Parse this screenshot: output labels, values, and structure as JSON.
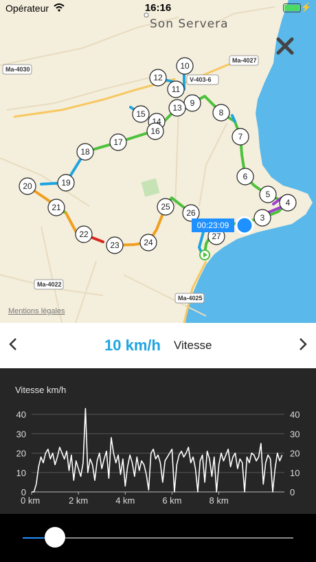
{
  "status_bar": {
    "carrier": "Opérateur",
    "time": "16:16",
    "battery_level": 1.0
  },
  "map": {
    "town": "Son Servera",
    "legal": "Mentions légales",
    "road_labels": [
      "Ma-4030",
      "Ma-4027",
      "V-403-6",
      "Ma-4022",
      "Ma-4025"
    ],
    "waypoints": [
      "3",
      "4",
      "5",
      "6",
      "7",
      "8",
      "9",
      "10",
      "11",
      "12",
      "13",
      "14",
      "15",
      "16",
      "17",
      "18",
      "19",
      "20",
      "21",
      "22",
      "23",
      "24",
      "25",
      "26",
      "27"
    ],
    "time_badge": "00:23:09",
    "colors": {
      "sea": "#5ab8ea",
      "land": "#f4eedc",
      "route_green": "#4cc13c",
      "route_blue": "#1ea4e0",
      "route_orange": "#f0a020",
      "route_red": "#d8281e",
      "route_purple": "#a040d0"
    }
  },
  "metric": {
    "value": "10 km/h",
    "label": "Vitesse",
    "prev_icon": "chevron-left-icon",
    "next_icon": "chevron-right-icon"
  },
  "chart_data": {
    "type": "line",
    "title": "Vitesse km/h",
    "x_unit": "km",
    "x_ticks": [
      "0 km",
      "2 km",
      "4 km",
      "6 km",
      "8 km"
    ],
    "y_ticks": [
      "0",
      "10",
      "20",
      "30",
      "40"
    ],
    "xlim": [
      0,
      10.8
    ],
    "ylim": [
      0,
      40
    ],
    "x": [
      0.0,
      0.1,
      0.2,
      0.3,
      0.4,
      0.5,
      0.6,
      0.7,
      0.8,
      0.9,
      1.0,
      1.1,
      1.2,
      1.3,
      1.4,
      1.5,
      1.6,
      1.7,
      1.8,
      1.9,
      2.0,
      2.1,
      2.2,
      2.3,
      2.4,
      2.5,
      2.6,
      2.7,
      2.8,
      2.9,
      3.0,
      3.1,
      3.2,
      3.3,
      3.4,
      3.5,
      3.6,
      3.7,
      3.8,
      3.9,
      4.0,
      4.1,
      4.2,
      4.3,
      4.4,
      4.5,
      4.6,
      4.7,
      4.8,
      4.9,
      5.0,
      5.1,
      5.2,
      5.3,
      5.4,
      5.5,
      5.6,
      5.7,
      5.8,
      5.9,
      6.0,
      6.1,
      6.2,
      6.3,
      6.4,
      6.5,
      6.6,
      6.7,
      6.8,
      6.9,
      7.0,
      7.1,
      7.2,
      7.3,
      7.4,
      7.5,
      7.6,
      7.7,
      7.8,
      7.9,
      8.0,
      8.1,
      8.2,
      8.3,
      8.4,
      8.5,
      8.6,
      8.7,
      8.8,
      8.9,
      9.0,
      9.1,
      9.2,
      9.3,
      9.4,
      9.5,
      9.6,
      9.7,
      9.8,
      9.9,
      10.0,
      10.1,
      10.2,
      10.3,
      10.4,
      10.5,
      10.6,
      10.7
    ],
    "y": [
      0,
      0,
      4,
      13,
      18,
      15,
      20,
      22,
      17,
      20,
      14,
      18,
      23,
      20,
      17,
      21,
      11,
      19,
      6,
      16,
      12,
      8,
      15,
      43,
      10,
      17,
      14,
      6,
      16,
      20,
      12,
      17,
      21,
      7,
      28,
      20,
      15,
      19,
      9,
      17,
      3,
      13,
      19,
      15,
      8,
      18,
      11,
      16,
      14,
      9,
      1,
      20,
      22,
      17,
      19,
      15,
      5,
      16,
      18,
      20,
      22,
      0,
      14,
      19,
      21,
      18,
      20,
      23,
      15,
      18,
      12,
      0,
      16,
      19,
      5,
      21,
      17,
      8,
      18,
      0,
      14,
      20,
      16,
      19,
      22,
      13,
      18,
      20,
      12,
      17,
      15,
      0,
      18,
      15,
      20,
      19,
      16,
      18,
      25,
      4,
      15,
      19,
      17,
      0,
      12,
      20,
      16,
      19
    ],
    "grid": true,
    "color": "#ffffff"
  },
  "playback": {
    "position": 0.12
  }
}
